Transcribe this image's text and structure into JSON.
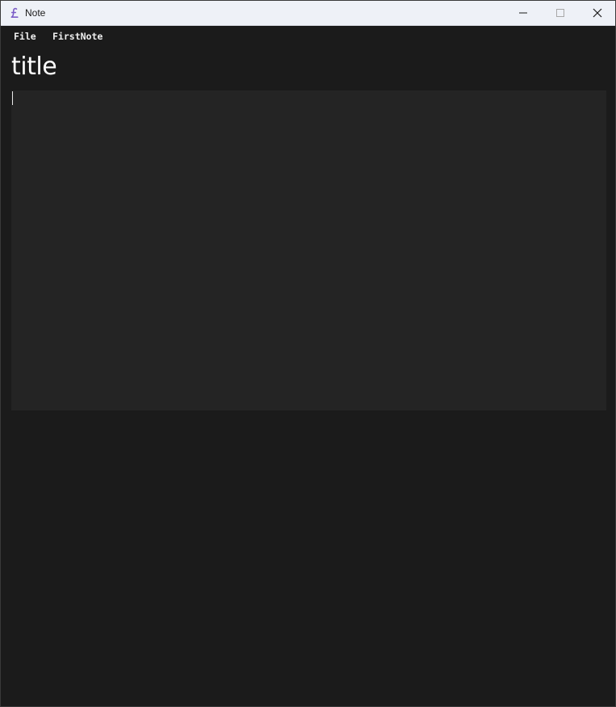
{
  "window": {
    "title": "Note",
    "controls": {
      "minimize": "minimize-icon",
      "maximize": "maximize-icon",
      "close": "close-icon"
    }
  },
  "menu": {
    "items": [
      {
        "label": "File"
      },
      {
        "label": "FirstNote"
      }
    ]
  },
  "note": {
    "title": "title",
    "body": ""
  },
  "colors": {
    "titlebar_bg": "#eef1f7",
    "app_bg": "#1b1b1b",
    "editor_bg": "#242424",
    "text": "#ffffff",
    "icon_accent": "#7b5cc7"
  }
}
